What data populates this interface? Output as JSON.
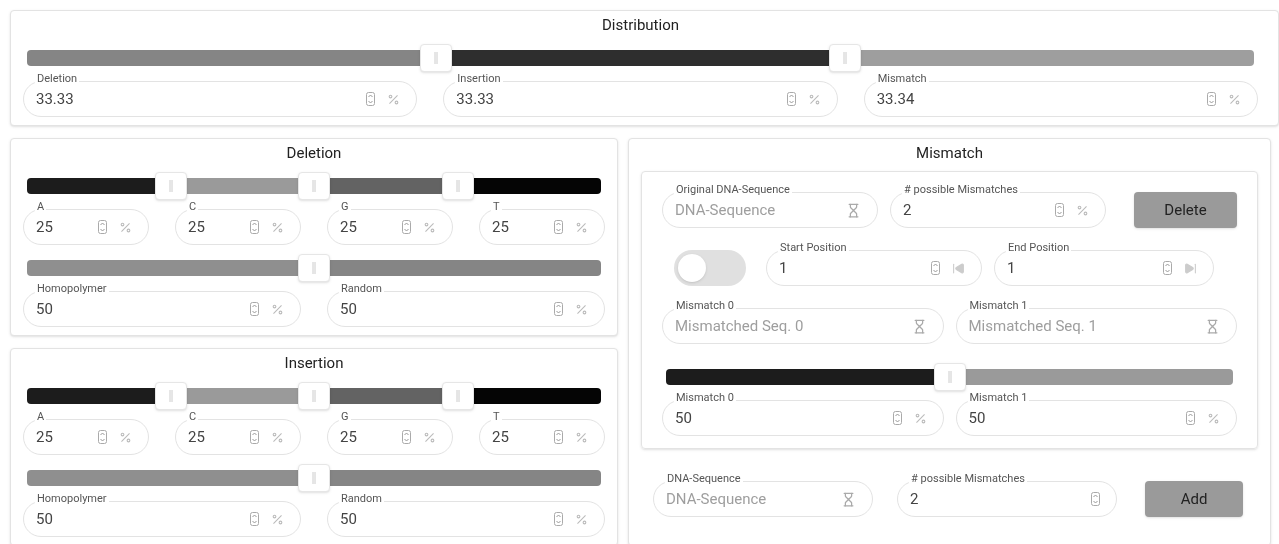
{
  "distribution": {
    "title": "Distribution",
    "slider": {
      "thumbs": [
        {
          "level": 0.3333
        },
        {
          "level": 0.6667
        }
      ],
      "segments": [
        {
          "color": "#858585"
        },
        {
          "color": "#2e2e2e"
        },
        {
          "color": "#9e9e9e"
        }
      ]
    },
    "fields": [
      {
        "label": "Deletion",
        "value": "33.33",
        "kind": "percent"
      },
      {
        "label": "Insertion",
        "value": "33.33",
        "kind": "percent"
      },
      {
        "label": "Mismatch",
        "value": "33.34",
        "kind": "percent"
      }
    ]
  },
  "deletion": {
    "title": "Deletion",
    "base_slider": {
      "thumbs": [
        {
          "level": 0.25
        },
        {
          "level": 0.5
        },
        {
          "level": 0.75
        }
      ],
      "segments": [
        {
          "color": "#1c1c1c"
        },
        {
          "color": "#9a9a9a"
        },
        {
          "color": "#636363"
        },
        {
          "color": "#050505"
        }
      ]
    },
    "base_fields": [
      {
        "label": "A",
        "value": "25",
        "kind": "percent"
      },
      {
        "label": "C",
        "value": "25",
        "kind": "percent"
      },
      {
        "label": "G",
        "value": "25",
        "kind": "percent"
      },
      {
        "label": "T",
        "value": "25",
        "kind": "percent"
      }
    ],
    "type_slider": {
      "thumbs": [
        {
          "level": 0.5
        }
      ],
      "segments": [
        {
          "color": "#8f8f8f"
        },
        {
          "color": "#858585"
        }
      ]
    },
    "type_fields": [
      {
        "label": "Homopolymer",
        "value": "50",
        "kind": "percent"
      },
      {
        "label": "Random",
        "value": "50",
        "kind": "percent"
      }
    ]
  },
  "insertion": {
    "title": "Insertion",
    "base_slider": {
      "thumbs": [
        {
          "level": 0.25
        },
        {
          "level": 0.5
        },
        {
          "level": 0.75
        }
      ],
      "segments": [
        {
          "color": "#1c1c1c"
        },
        {
          "color": "#9a9a9a"
        },
        {
          "color": "#636363"
        },
        {
          "color": "#050505"
        }
      ]
    },
    "base_fields": [
      {
        "label": "A",
        "value": "25",
        "kind": "percent"
      },
      {
        "label": "C",
        "value": "25",
        "kind": "percent"
      },
      {
        "label": "G",
        "value": "25",
        "kind": "percent"
      },
      {
        "label": "T",
        "value": "25",
        "kind": "percent"
      }
    ],
    "type_slider": {
      "thumbs": [
        {
          "level": 0.5
        }
      ],
      "segments": [
        {
          "color": "#8f8f8f"
        },
        {
          "color": "#858585"
        }
      ]
    },
    "type_fields": [
      {
        "label": "Homopolymer",
        "value": "50",
        "kind": "percent"
      },
      {
        "label": "Random",
        "value": "50",
        "kind": "percent"
      }
    ]
  },
  "mismatch": {
    "title": "Mismatch",
    "entry": {
      "sequence": {
        "label": "Original DNA-Sequence",
        "placeholder": "DNA-Sequence",
        "kind": "sequence"
      },
      "count": {
        "label": "# possible Mismatches",
        "value": "2",
        "kind": "percent"
      },
      "delete_button": "Delete",
      "toggle": {
        "on": false
      },
      "start": {
        "label": "Start Position",
        "value": "1",
        "kind": "start"
      },
      "end": {
        "label": "End Position",
        "value": "1",
        "kind": "end"
      },
      "sequences": [
        {
          "label": "Mismatch 0",
          "placeholder": "Mismatched Seq. 0",
          "kind": "sequence"
        },
        {
          "label": "Mismatch 1",
          "placeholder": "Mismatched Seq. 1",
          "kind": "sequence"
        }
      ],
      "slider": {
        "thumbs": [
          {
            "level": 0.5
          }
        ],
        "segments": [
          {
            "color": "#1c1c1c"
          },
          {
            "color": "#9a9a9a"
          }
        ]
      },
      "shares": [
        {
          "label": "Mismatch 0",
          "value": "50",
          "kind": "percent"
        },
        {
          "label": "Mismatch 1",
          "value": "50",
          "kind": "percent"
        }
      ]
    },
    "new": {
      "sequence": {
        "label": "DNA-Sequence",
        "placeholder": "DNA-Sequence",
        "kind": "sequence"
      },
      "count": {
        "label": "# possible Mismatches",
        "value": "2",
        "kind": "number"
      },
      "add_button": "Add"
    }
  }
}
